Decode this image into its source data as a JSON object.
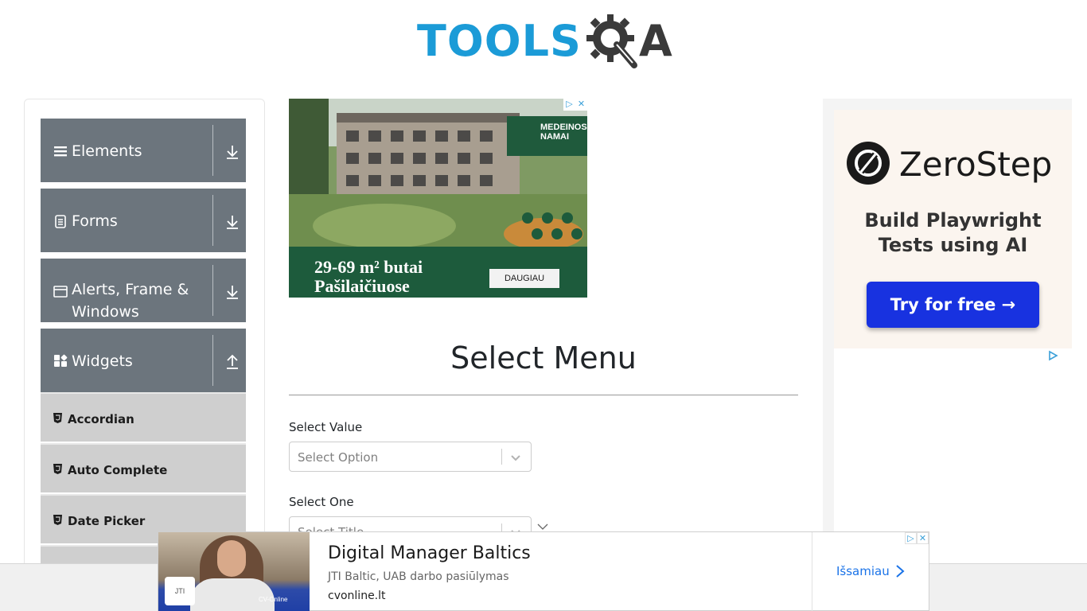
{
  "header": {
    "logo_text_main": "TOOLS",
    "logo_text_a": "A"
  },
  "sidebar": {
    "groups": [
      {
        "label": "Elements",
        "icon": "hamburger-icon",
        "arrow": "download-arrow-icon"
      },
      {
        "label": "Forms",
        "icon": "document-icon",
        "arrow": "download-arrow-icon"
      },
      {
        "label": "Alerts, Frame & Windows",
        "icon": "window-icon",
        "arrow": "download-arrow-icon"
      },
      {
        "label": "Widgets",
        "icon": "widgets-icon",
        "arrow": "upload-arrow-icon"
      }
    ],
    "items": [
      {
        "label": "Accordian",
        "icon": "html5-icon"
      },
      {
        "label": "Auto Complete",
        "icon": "html5-icon"
      },
      {
        "label": "Date Picker",
        "icon": "html5-icon"
      }
    ]
  },
  "ad_top": {
    "brand": "MEDEINOS NAMAI",
    "headline_line1": "29-69 m² butai",
    "headline_line2": "Pašilaičiuose",
    "cta": "DAUGIAU"
  },
  "main": {
    "title": "Select Menu",
    "fields": [
      {
        "label": "Select Value",
        "placeholder": "Select Option"
      },
      {
        "label": "Select One",
        "placeholder": "Select Title"
      }
    ]
  },
  "ad_right": {
    "brand": "ZeroStep",
    "tagline_line1": "Build Playwright",
    "tagline_line2": "Tests using AI",
    "cta": "Try for free →"
  },
  "banner": {
    "title": "Digital Manager Baltics",
    "subtitle": "JTI Baltic, UAB darbo pasiūlymas",
    "url": "cvonline.lt",
    "cta": "Išsamiau",
    "jti": "JTI",
    "cv": "CV-Online"
  },
  "colors": {
    "sidebar_group_bg": "#6c757d",
    "sidebar_item_bg": "#cfcfcf",
    "logo_blue": "#1b9bd7",
    "cta_blue": "#1832e0"
  }
}
